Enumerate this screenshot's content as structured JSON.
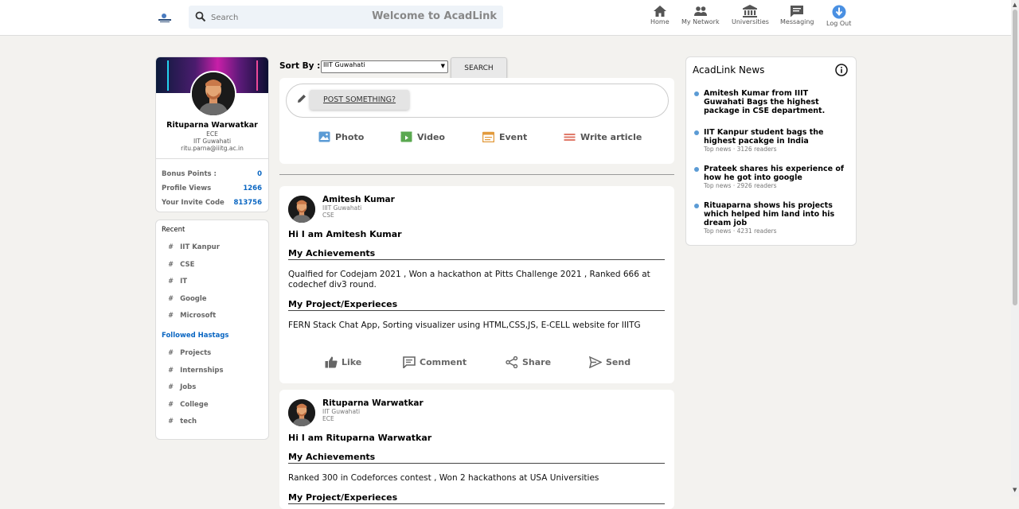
{
  "header": {
    "search_placeholder": "Search",
    "welcome": "Welcome to AcadLink",
    "nav": [
      {
        "label": "Home",
        "icon": "home-icon"
      },
      {
        "label": "My Network",
        "icon": "network-icon"
      },
      {
        "label": "Universities",
        "icon": "university-icon"
      },
      {
        "label": "Messaging",
        "icon": "message-icon"
      },
      {
        "label": "Log Out",
        "icon": "logout-icon"
      }
    ]
  },
  "profile": {
    "name": "Rituparna Warwatkar",
    "branch": "ECE",
    "college": "IIT Guwahati",
    "email": "ritu.parna@iiitg.ac.in",
    "stats": [
      {
        "label": "Bonus Points :",
        "value": "0"
      },
      {
        "label": "Profile Views",
        "value": "1266"
      },
      {
        "label": "Your Invite Code",
        "value": "813756"
      }
    ]
  },
  "recent": {
    "title": "Recent",
    "tags": [
      "IIT Kanpur",
      "CSE",
      "IT",
      "Google",
      "Microsoft"
    ],
    "followed_title": "Followed Hastags",
    "followed": [
      "Projects",
      "Internships",
      "Jobs",
      "College",
      "tech"
    ]
  },
  "sort": {
    "label": "Sort By :",
    "selected": "IIIT Guwahati",
    "button": "SEARCH"
  },
  "share": {
    "post_button": "POST SOMETHING?",
    "options": [
      {
        "label": "Photo",
        "icon": "photo-icon",
        "color": "#5b9bd5"
      },
      {
        "label": "Video",
        "icon": "video-icon",
        "color": "#5aa850"
      },
      {
        "label": "Event",
        "icon": "event-icon",
        "color": "#e29a3c"
      },
      {
        "label": "Write article",
        "icon": "article-icon",
        "color": "#e07a6a"
      }
    ]
  },
  "posts": [
    {
      "author": "Amitesh Kumar",
      "college": "IIIT Guwahati",
      "branch": "CSE",
      "greeting": "Hi I am Amitesh Kumar",
      "achievements_title": "My Achievements",
      "achievements": "Qualfied for Codejam 2021 , Won a hackathon at Pitts Challenge 2021 , Ranked 666 at codechef div3 round.",
      "projects_title": "My Project/Experieces",
      "projects": "FERN Stack Chat App, Sorting visualizer using HTML,CSS,JS, E-CELL website for IIITG",
      "actions": [
        "Like",
        "Comment",
        "Share",
        "Send"
      ]
    },
    {
      "author": "Rituparna Warwatkar",
      "college": "IIT Guwahati",
      "branch": "ECE",
      "greeting": "Hi I am Rituparna Warwatkar",
      "achievements_title": "My Achievements",
      "achievements": "Ranked 300 in Codeforces contest , Won 2 hackathons at USA Universities",
      "projects_title": "My Project/Experieces"
    }
  ],
  "news": {
    "title": "AcadLink News",
    "items": [
      {
        "headline": "Amitesh Kumar from IIIT Guwahati Bags the highest package in CSE department.",
        "sub": ""
      },
      {
        "headline": "IIT Kanpur student bags the highest pacakge in India",
        "sub": "Top news · 3126 readers"
      },
      {
        "headline": "Prateek shares his experience of how he got into google",
        "sub": "Top news · 2926 readers"
      },
      {
        "headline": "Rituaparna shows his projects which helped him land into his dream job",
        "sub": "Top news · 4231 readers"
      }
    ]
  },
  "colors": {
    "accent": "#0a66c2",
    "background": "#f3f2ef",
    "news_dot": "#5b9bd5"
  }
}
